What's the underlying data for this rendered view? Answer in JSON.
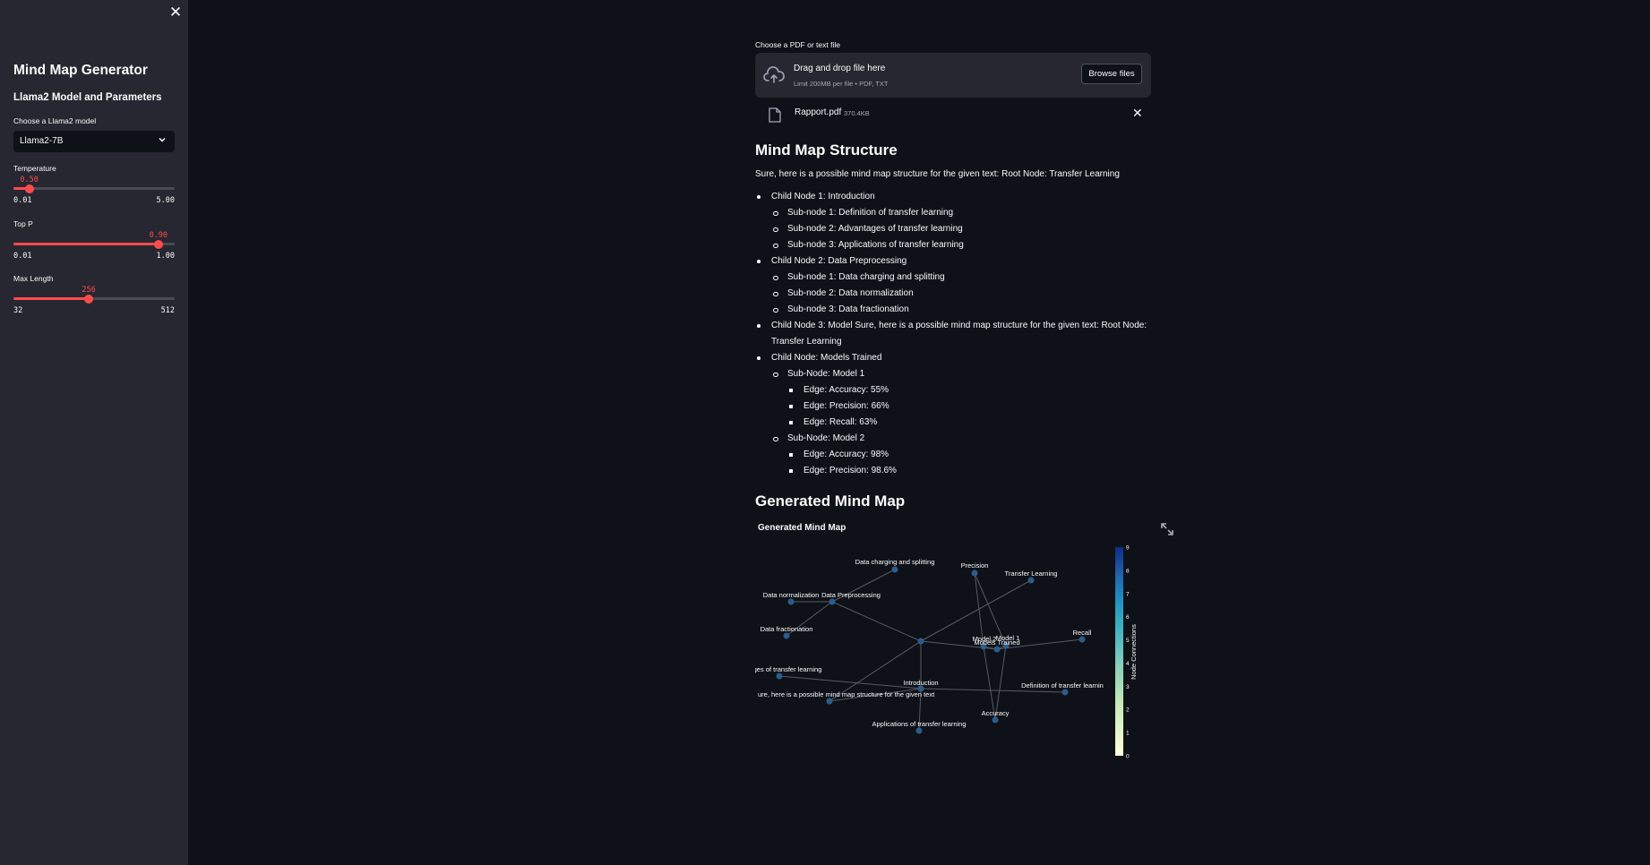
{
  "sidebar": {
    "close_icon": "close-icon",
    "title": "Mind Map Generator",
    "subtitle": "Llama2 Model and Parameters",
    "model_label": "Choose a Llama2 model",
    "model_value": "Llama2-7B",
    "temperature": {
      "label": "Temperature",
      "value": "0.50",
      "min": "0.01",
      "max": "5.00",
      "fraction": 0.098
    },
    "top_p": {
      "label": "Top P",
      "value": "0.90",
      "min": "0.01",
      "max": "1.00",
      "fraction": 0.899
    },
    "max_length": {
      "label": "Max Length",
      "value": "256",
      "min": "32",
      "max": "512",
      "fraction": 0.467
    }
  },
  "upload": {
    "label": "Choose a PDF or text file",
    "drop_title": "Drag and drop file here",
    "drop_limit": "Limit 200MB per file • PDF, TXT",
    "browse_label": "Browse files",
    "file_name": "Rapport.pdf",
    "file_size": "370.4KB"
  },
  "structure": {
    "heading": "Mind Map Structure",
    "intro": "Sure, here is a possible mind map structure for the given text: Root Node: Transfer Learning",
    "items": [
      {
        "level": 1,
        "text": "Child Node 1: Introduction"
      },
      {
        "level": 2,
        "text": "Sub-node 1: Definition of transfer learning"
      },
      {
        "level": 2,
        "text": "Sub-node 2: Advantages of transfer learning"
      },
      {
        "level": 2,
        "text": "Sub-node 3: Applications of transfer learning"
      },
      {
        "level": 1,
        "text": "Child Node 2: Data Preprocessing"
      },
      {
        "level": 2,
        "text": "Sub-node 1: Data charging and splitting"
      },
      {
        "level": 2,
        "text": "Sub-node 2: Data normalization"
      },
      {
        "level": 2,
        "text": "Sub-node 3: Data fractionation"
      },
      {
        "level": 1,
        "text": "Child Node 3: Model Sure, here is a possible mind map structure for the given text: Root Node: Transfer Learning"
      },
      {
        "level": 1,
        "text": "Child Node: Models Trained"
      },
      {
        "level": 2,
        "text": "Sub-Node: Model 1"
      },
      {
        "level": 3,
        "text": "Edge: Accuracy: 55%"
      },
      {
        "level": 3,
        "text": "Edge: Precision: 66%"
      },
      {
        "level": 3,
        "text": "Edge: Recall: 63%"
      },
      {
        "level": 2,
        "text": "Sub-Node: Model 2"
      },
      {
        "level": 3,
        "text": "Edge: Accuracy: 98%"
      },
      {
        "level": 3,
        "text": "Edge: Precision: 98.6%"
      }
    ]
  },
  "mindmap": {
    "heading": "Generated Mind Map",
    "chart_title": "Generated Mind Map",
    "colorbar_label": "Node Connections",
    "colorbar_ticks": [
      "0",
      "1",
      "2",
      "3",
      "4",
      "5",
      "6",
      "7",
      "8",
      "9"
    ],
    "node_color": "#2a5d8e",
    "edge_color": "#555a66"
  },
  "chart_data": {
    "type": "network",
    "title": "Generated Mind Map",
    "colorbar": {
      "label": "Node Connections",
      "range": [
        0,
        9
      ]
    },
    "nodes": [
      {
        "id": "center",
        "label": ""
      },
      {
        "id": "dcs",
        "label": "Data charging and splitting"
      },
      {
        "id": "dp",
        "label": "Data Preprocessing"
      },
      {
        "id": "dn",
        "label": "Data normalization"
      },
      {
        "id": "df",
        "label": "Data fractionation"
      },
      {
        "id": "adv",
        "label": "ges of transfer learning"
      },
      {
        "id": "sure",
        "label": "ure, here is a possible mind map structure for the given text"
      },
      {
        "id": "intro",
        "label": "Introduction"
      },
      {
        "id": "app",
        "label": "Applications of transfer learning"
      },
      {
        "id": "prec",
        "label": "Precision"
      },
      {
        "id": "tl",
        "label": "Transfer Learning"
      },
      {
        "id": "m2",
        "label": "Model 2"
      },
      {
        "id": "m1",
        "label": "Model 1"
      },
      {
        "id": "mt",
        "label": "Models Trained"
      },
      {
        "id": "recall",
        "label": "Recall"
      },
      {
        "id": "def",
        "label": "Definition of transfer learnin"
      },
      {
        "id": "acc",
        "label": "Accuracy"
      }
    ],
    "edges": [
      [
        "dcs",
        "dp"
      ],
      [
        "dn",
        "dp"
      ],
      [
        "df",
        "dp"
      ],
      [
        "dp",
        "center"
      ],
      [
        "center",
        "tl"
      ],
      [
        "center",
        "sure"
      ],
      [
        "center",
        "intro"
      ],
      [
        "center",
        "mt"
      ],
      [
        "intro",
        "app"
      ],
      [
        "adv",
        "intro"
      ],
      [
        "sure",
        "intro"
      ],
      [
        "intro",
        "def"
      ],
      [
        "prec",
        "m2"
      ],
      [
        "prec",
        "m1"
      ],
      [
        "mt",
        "m2"
      ],
      [
        "mt",
        "m1"
      ],
      [
        "mt",
        "recall"
      ],
      [
        "m2",
        "acc"
      ],
      [
        "m1",
        "acc"
      ]
    ]
  }
}
